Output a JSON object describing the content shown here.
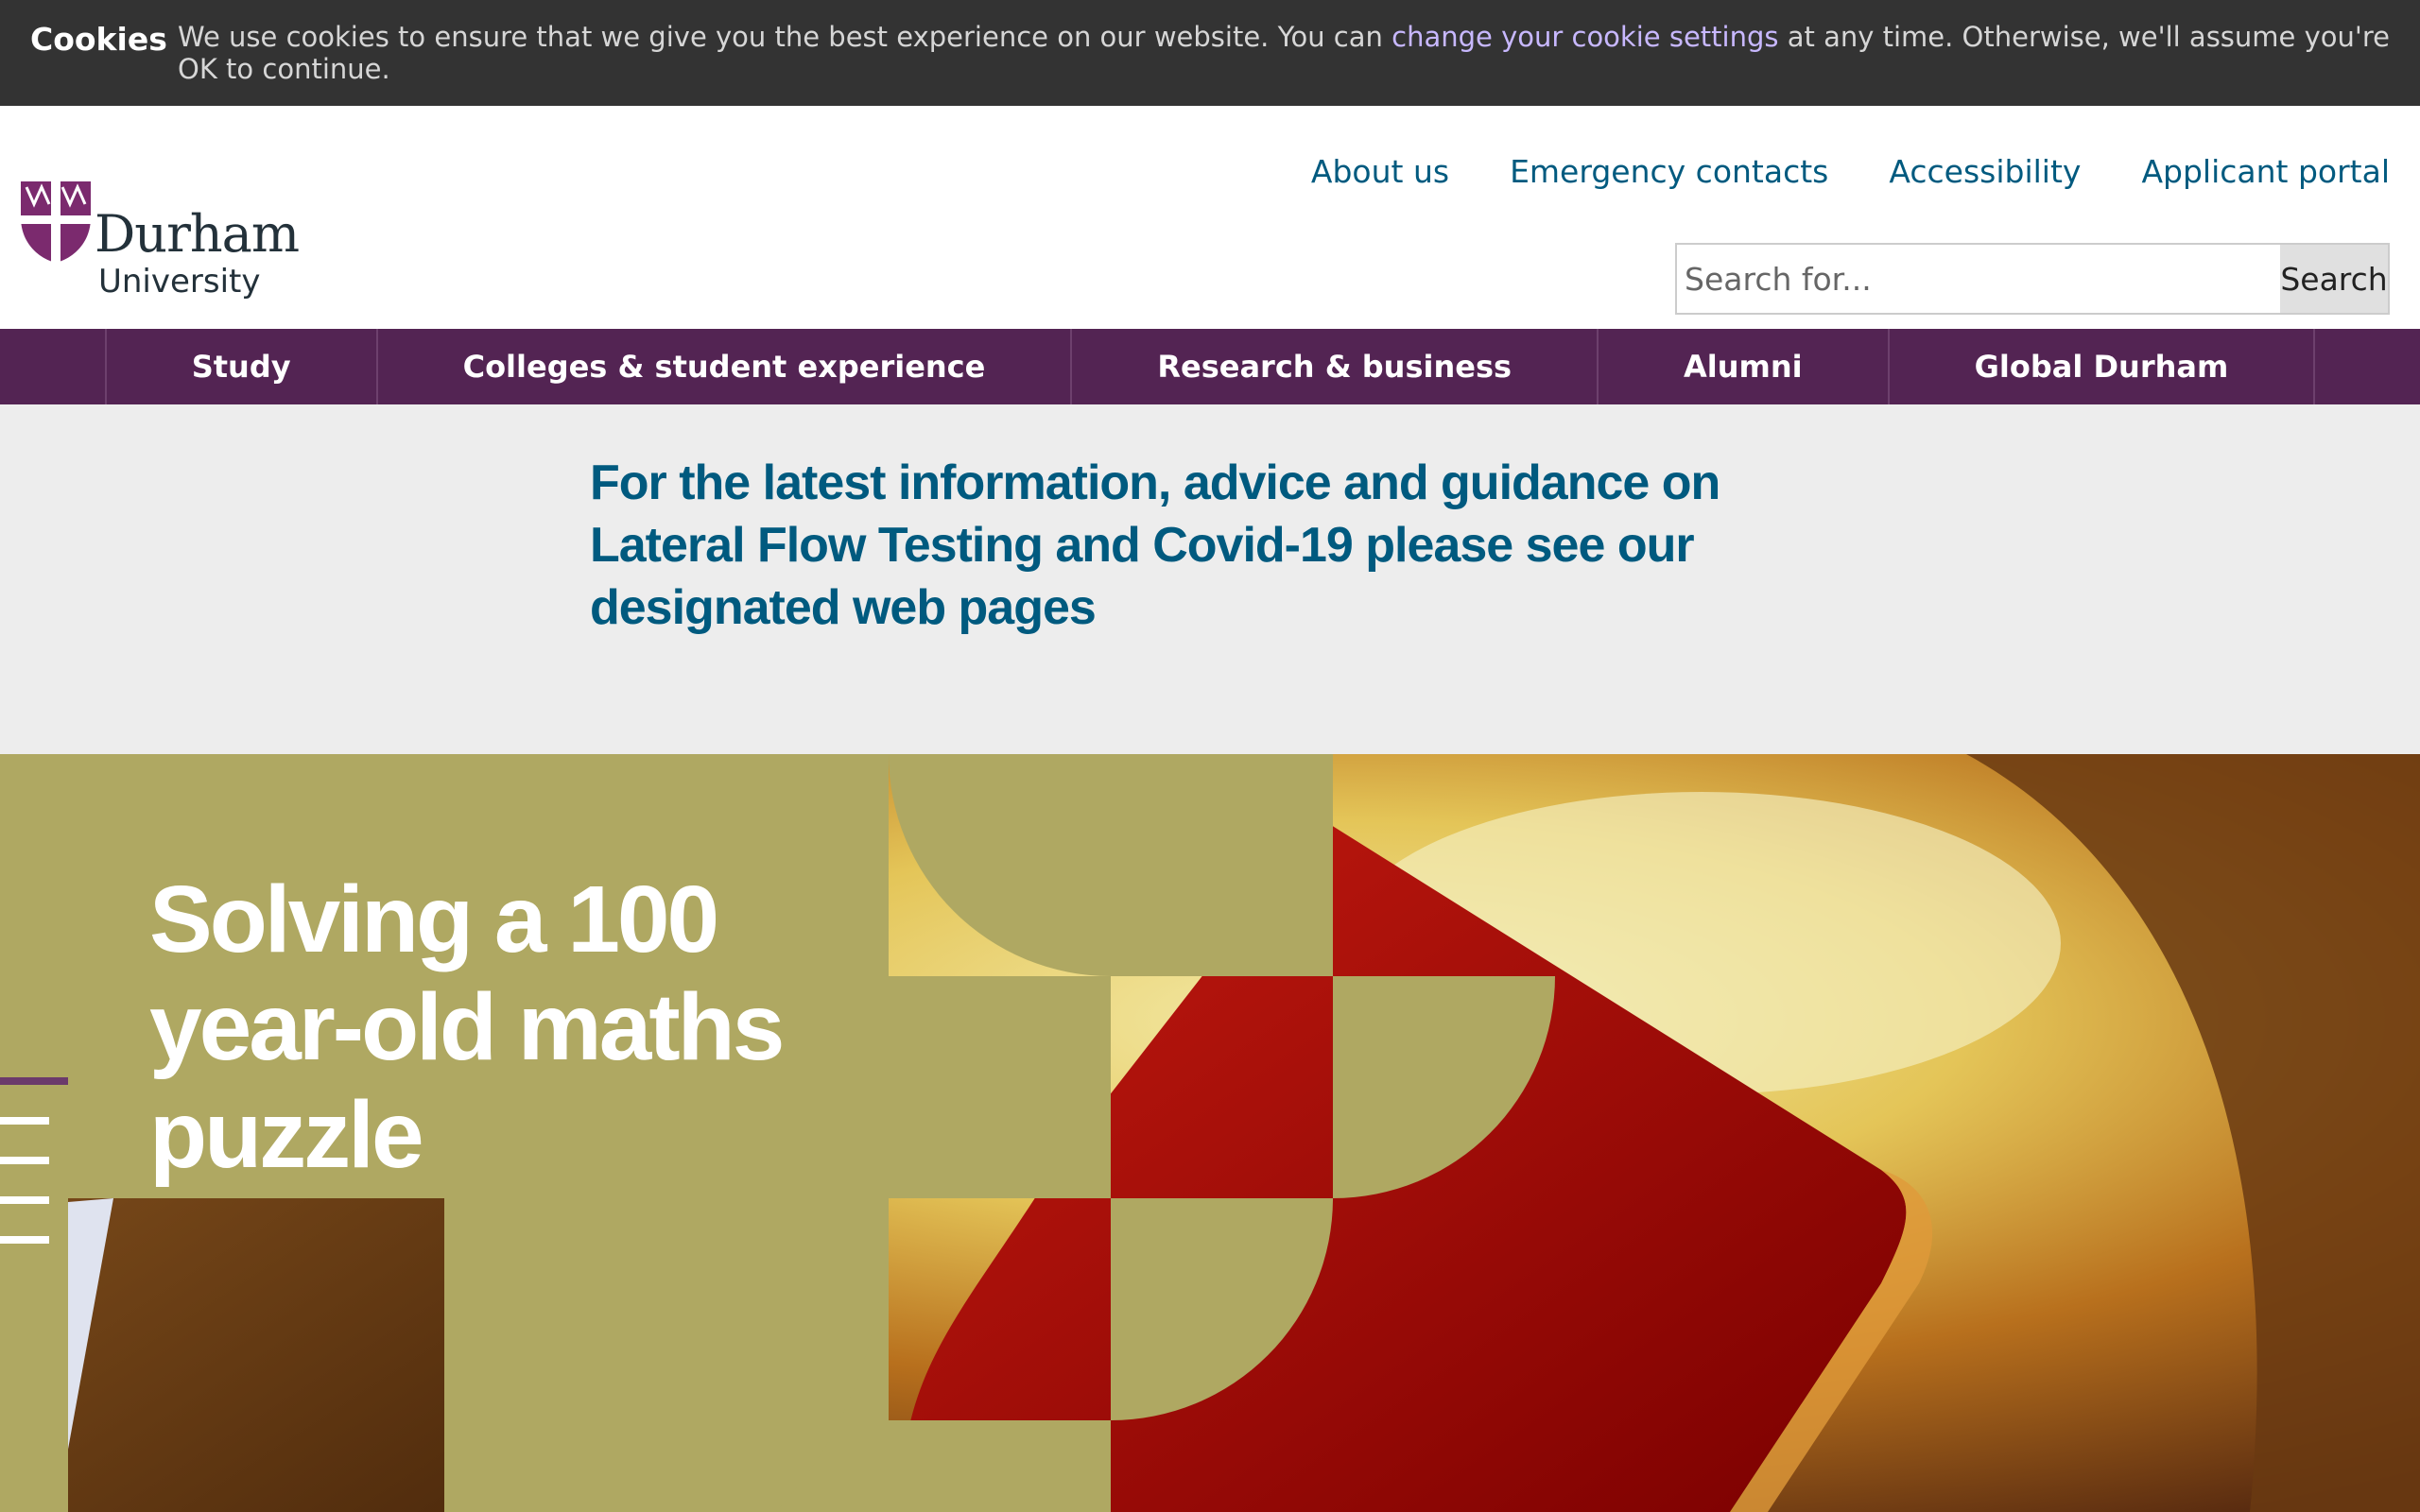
{
  "cookie": {
    "title": "Cookies",
    "text_before": "We use cookies to ensure that we give you the best experience on our website. You can ",
    "link": "change your cookie settings",
    "text_after": " at any time. Otherwise, we'll assume you're OK to continue."
  },
  "logo": {
    "word1": "Durham",
    "word2": "University",
    "shield_color": "#7b2a6e"
  },
  "top_links": [
    "About us",
    "Emergency contacts",
    "Accessibility",
    "Applicant portal"
  ],
  "search": {
    "placeholder": "Search for...",
    "button": "Search"
  },
  "nav": [
    "Study",
    "Colleges & student experience",
    "Research & business",
    "Alumni",
    "Global Durham"
  ],
  "notice": {
    "text": "For the latest information, advice and guidance on Lateral Flow Testing and Covid-19 please see our designated web pages"
  },
  "hero": {
    "title": "Solving a 100 year-old maths puzzle",
    "slider_count": 4,
    "active_slide": 1
  },
  "colors": {
    "nav_purple": "#532453",
    "link_blue": "#005a7f",
    "olive": "#afa862",
    "cookie_bg": "#333333",
    "notice_bg": "#ededed"
  }
}
